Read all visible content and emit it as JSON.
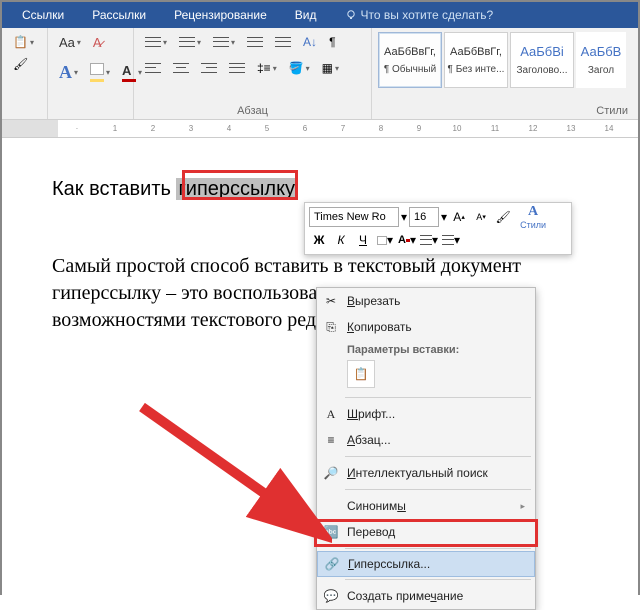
{
  "menubar": {
    "tabs": [
      "Ссылки",
      "Рассылки",
      "Рецензирование",
      "Вид"
    ],
    "tellme": "Что вы хотите сделать?"
  },
  "ribbon": {
    "paragraph_label": "Абзац",
    "styles_label": "Стили",
    "styles": [
      {
        "preview": "АаБбВвГг,",
        "name": "¶ Обычный"
      },
      {
        "preview": "АаБбВвГг,",
        "name": "¶ Без инте..."
      },
      {
        "preview": "АаБбВі",
        "name": "Заголово..."
      },
      {
        "preview": "АаБбВ",
        "name": "Загол"
      }
    ]
  },
  "ruler": [
    "1",
    "",
    "1",
    "2",
    "3",
    "4",
    "5",
    "6",
    "7",
    "8",
    "9",
    "10",
    "11",
    "12",
    "13",
    "14"
  ],
  "doc": {
    "title_pre": "Как вставить ",
    "title_sel": "гиперссылку",
    "body": "Самый простой способ вставить в текстовый документ гиперссылку – это воспользоваться встроенными возможностями текстового редактора «Microsoft Word»."
  },
  "minitoolbar": {
    "font": "Times New Ro",
    "size": "16",
    "bold": "Ж",
    "italic": "К",
    "underline": "Ч",
    "styles": "Стили"
  },
  "ctx": {
    "cut": "Вырезать",
    "copy": "Копировать",
    "paste_header": "Параметры вставки:",
    "font": "Шрифт...",
    "para": "Абзац...",
    "smart": "Интеллектуальный поиск",
    "syn": "Синонимы",
    "trans": "Перевод",
    "link": "Гиперссылка...",
    "comment": "Создать примечание"
  }
}
